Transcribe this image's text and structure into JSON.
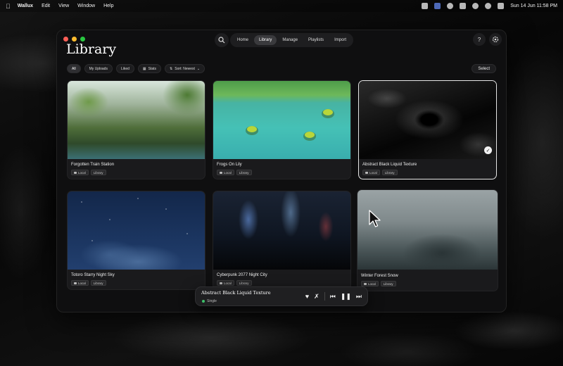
{
  "menubar": {
    "app_name": "Wallux",
    "menus": [
      "Edit",
      "View",
      "Window",
      "Help"
    ],
    "clock": "Sun 14 Jun  11:58 PM"
  },
  "window": {
    "title": "Library",
    "nav_tabs": [
      "Home",
      "Library",
      "Manage",
      "Playlists",
      "Import"
    ],
    "active_tab": "Library",
    "help_label": "?"
  },
  "filters": {
    "chips": [
      "All",
      "My Uploads",
      "Liked",
      "Stats",
      "Sort: Newest"
    ],
    "select_label": "Select"
  },
  "wallpapers": [
    {
      "title": "Forgotten Train Station",
      "tags": [
        "Local",
        "Library"
      ]
    },
    {
      "title": "Frogs On Lily",
      "tags": [
        "Local",
        "Library"
      ]
    },
    {
      "title": "Abstract Black Liquid Texture",
      "tags": [
        "Local",
        "Library"
      ],
      "selected": true
    },
    {
      "title": "Totoro Starry Night Sky",
      "tags": [
        "Local",
        "Library"
      ]
    },
    {
      "title": "Cyberpunk 2077 Night City",
      "tags": [
        "Local",
        "Library"
      ]
    },
    {
      "title": "Winter Forest Snow",
      "tags": [
        "Local",
        "Library"
      ]
    }
  ],
  "player": {
    "track": "Abstract Black Liquid Texture",
    "mode": "Single",
    "status_color": "#3fc06a"
  }
}
